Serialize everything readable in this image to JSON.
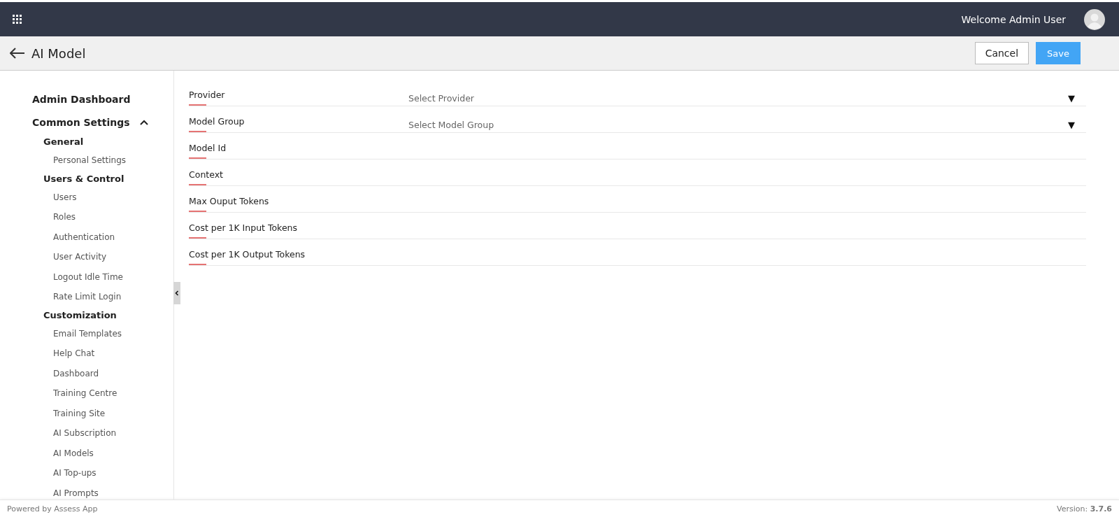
{
  "topbar": {
    "welcome": "Welcome Admin User"
  },
  "header": {
    "title": "AI Model",
    "buttons": [
      {
        "label": "Cancel",
        "kind": "secondary"
      },
      {
        "label": "Save",
        "kind": "primary"
      }
    ]
  },
  "sidebar": {
    "items": [
      {
        "label": "Admin Dashboard"
      },
      {
        "label": "Common Settings",
        "expanded": true,
        "children": [
          {
            "label": "General",
            "children": [
              {
                "label": "Personal Settings"
              }
            ]
          },
          {
            "label": "Users & Control",
            "children": [
              {
                "label": "Users"
              },
              {
                "label": "Roles"
              },
              {
                "label": "Authentication"
              },
              {
                "label": "User Activity"
              },
              {
                "label": "Logout Idle Time"
              },
              {
                "label": "Rate Limit Login"
              }
            ]
          },
          {
            "label": "Customization",
            "children": [
              {
                "label": "Email Templates"
              },
              {
                "label": "Help Chat"
              },
              {
                "label": "Dashboard"
              },
              {
                "label": "Training Centre"
              },
              {
                "label": "Training Site"
              },
              {
                "label": "AI Subscription"
              },
              {
                "label": "AI Models"
              },
              {
                "label": "AI Top-ups"
              },
              {
                "label": "AI Prompts"
              }
            ]
          }
        ]
      }
    ]
  },
  "form": {
    "fields": [
      {
        "label": "Provider",
        "kind": "select",
        "placeholder": "Select Provider",
        "arrow": "▼"
      },
      {
        "label": "Model Group",
        "kind": "select",
        "placeholder": "Select Model Group",
        "arrow": "▼"
      },
      {
        "label": "Model Id",
        "kind": "text"
      },
      {
        "label": "Context",
        "kind": "text"
      },
      {
        "label": "Max Ouput Tokens",
        "kind": "text"
      },
      {
        "label": "Cost per 1K Input Tokens",
        "kind": "text"
      },
      {
        "label": "Cost per 1K Output Tokens",
        "kind": "text"
      }
    ]
  },
  "footer": {
    "left": "Powered by Assess App",
    "right": "Version: **3.7.6**"
  }
}
